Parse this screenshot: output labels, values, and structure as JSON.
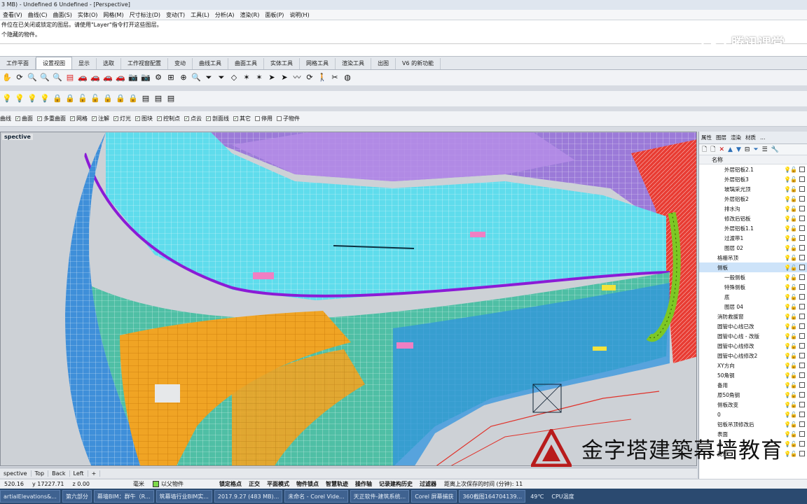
{
  "window": {
    "title": "3 MB) - Undefined 6 Undefined - [Perspective]"
  },
  "menu": [
    "查看(V)",
    "曲线(C)",
    "曲面(S)",
    "实体(O)",
    "网格(M)",
    "尺寸标注(D)",
    "变动(T)",
    "工具(L)",
    "分析(A)",
    "渲染(R)",
    "面板(P)",
    "说明(H)"
  ],
  "command_history": [
    "件位在已关闭或锁定的图层。请使用\"Layer\"指令打开这些图层。",
    "个隐藏的物件。"
  ],
  "watermark": "腾讯课堂",
  "toolbar_tabs": [
    {
      "label": "工作平面",
      "active": false
    },
    {
      "label": "设置视图",
      "active": true
    },
    {
      "label": "显示",
      "active": false
    },
    {
      "label": "选取",
      "active": false
    },
    {
      "label": "工作视窗配置",
      "active": false
    },
    {
      "label": "变动",
      "active": false
    },
    {
      "label": "曲线工具",
      "active": false
    },
    {
      "label": "曲面工具",
      "active": false
    },
    {
      "label": "实体工具",
      "active": false
    },
    {
      "label": "网格工具",
      "active": false
    },
    {
      "label": "渲染工具",
      "active": false
    },
    {
      "label": "出图",
      "active": false
    },
    {
      "label": "V6 的新功能",
      "active": false
    }
  ],
  "tool_icons_row1": [
    "pan-icon",
    "rotate-view-icon",
    "zoom-icon",
    "zoom-window-icon",
    "zoom-extents-icon",
    "layer-red-icon",
    "car-red-icon",
    "car-red-2-icon",
    "car-red-3-icon",
    "car-red-4-icon",
    "camera-icon",
    "camera-2-icon",
    "set-camera-icon",
    "grid-target-icon",
    "target-icon",
    "zoom-target-icon",
    "funnel-icon",
    "funnel-2-icon",
    "plane-icon",
    "star-icon",
    "star-2-icon",
    "arrow-icon",
    "arrow-2-icon",
    "wave-icon",
    "rotate-icon",
    "walk-icon",
    "twist-icon",
    "globe-icon"
  ],
  "tool_icons_row2": [
    "bulb-lock-icon",
    "bulb-icon",
    "bulb-off-icon",
    "bulb-set-icon",
    "lock-icon",
    "lock-2-icon",
    "unlock-icon",
    "unlock-2-icon",
    "lock-set-icon",
    "lock-set-2-icon",
    "lock-set-3-icon",
    "layer-1-icon",
    "layer-2-icon",
    "layer-3-icon"
  ],
  "filters": [
    {
      "label": "曲线",
      "checked": false,
      "has_box": false
    },
    {
      "label": "曲面",
      "checked": true,
      "has_box": true
    },
    {
      "label": "多重曲面",
      "checked": true,
      "has_box": true
    },
    {
      "label": "网格",
      "checked": true,
      "has_box": true
    },
    {
      "label": "注解",
      "checked": true,
      "has_box": true
    },
    {
      "label": "灯光",
      "checked": true,
      "has_box": true
    },
    {
      "label": "图块",
      "checked": true,
      "has_box": true
    },
    {
      "label": "控制点",
      "checked": true,
      "has_box": true
    },
    {
      "label": "点云",
      "checked": true,
      "has_box": true
    },
    {
      "label": "剖面线",
      "checked": true,
      "has_box": true
    },
    {
      "label": "其它",
      "checked": true,
      "has_box": true
    },
    {
      "label": "停用",
      "checked": false,
      "has_box": true
    },
    {
      "label": "子物件",
      "checked": false,
      "has_box": true
    }
  ],
  "viewport": {
    "label": "spective"
  },
  "view_tabs": [
    "spective",
    "Top",
    "Back",
    "Left",
    "+"
  ],
  "panel": {
    "tabs": [
      "属性",
      "图层",
      "渲染",
      "材质",
      "…"
    ],
    "header": "名称",
    "layers": [
      {
        "name": "外层铝板2.1",
        "indent": 36,
        "selected": false,
        "color": "#ffffff"
      },
      {
        "name": "外层铝板3",
        "indent": 36,
        "selected": false,
        "color": "#ffffff"
      },
      {
        "name": "玻璃采光顶",
        "indent": 36,
        "selected": false,
        "color": "#ffffff"
      },
      {
        "name": "外层铝板2",
        "indent": 36,
        "selected": false,
        "color": "#ffffff"
      },
      {
        "name": "排水沟",
        "indent": 36,
        "selected": false,
        "color": "#ffffff"
      },
      {
        "name": "修改后铝板",
        "indent": 36,
        "selected": false,
        "color": "#ffffff"
      },
      {
        "name": "外层铝板1.1",
        "indent": 36,
        "selected": false,
        "color": "#ffffff"
      },
      {
        "name": "过渡带1",
        "indent": 36,
        "selected": false,
        "color": "#ffffff"
      },
      {
        "name": "图层 02",
        "indent": 36,
        "selected": false,
        "color": "#ffffff"
      },
      {
        "name": "格栅吊顶",
        "indent": 26,
        "selected": false,
        "color": "#ffffff"
      },
      {
        "name": "侧板",
        "indent": 26,
        "selected": true,
        "color": "#ffffff"
      },
      {
        "name": "一般侧板",
        "indent": 36,
        "selected": false,
        "color": "#ffffff"
      },
      {
        "name": "特殊侧板",
        "indent": 36,
        "selected": false,
        "color": "#ffffff"
      },
      {
        "name": "底",
        "indent": 36,
        "selected": false,
        "color": "#ffffff"
      },
      {
        "name": "图层 04",
        "indent": 36,
        "selected": false,
        "color": "#ffffff"
      },
      {
        "name": "消防救援窗",
        "indent": 26,
        "selected": false,
        "color": "#ffffff"
      },
      {
        "name": "圆管中心线已改",
        "indent": 26,
        "selected": false,
        "color": "#ffffff"
      },
      {
        "name": "圆管中心线 - 改版",
        "indent": 26,
        "selected": false,
        "color": "#ffffff"
      },
      {
        "name": "圆管中心线修改",
        "indent": 26,
        "selected": false,
        "color": "#ffffff"
      },
      {
        "name": "圆管中心线修改2",
        "indent": 26,
        "selected": false,
        "color": "#ffffff"
      },
      {
        "name": "XY方向",
        "indent": 26,
        "selected": false,
        "color": "#ffffff"
      },
      {
        "name": "50角钢",
        "indent": 26,
        "selected": false,
        "color": "#ffffff"
      },
      {
        "name": "备用",
        "indent": 26,
        "selected": false,
        "color": "#ffffff"
      },
      {
        "name": "原50角钢",
        "indent": 26,
        "selected": false,
        "color": "#ffffff"
      },
      {
        "name": "侧板改变",
        "indent": 26,
        "selected": false,
        "color": "#ffffff"
      },
      {
        "name": "0",
        "indent": 26,
        "selected": false,
        "color": "#ffffff"
      },
      {
        "name": "铝板吊顶修改后",
        "indent": 26,
        "selected": false,
        "color": "#ffffff"
      },
      {
        "name": "表面",
        "indent": 26,
        "selected": false,
        "color": "#ffffff"
      },
      {
        "name": "点",
        "indent": 26,
        "selected": false,
        "color": "#ffffff"
      },
      {
        "name": "变形",
        "indent": 26,
        "selected": false,
        "color": "#ffffff"
      }
    ]
  },
  "status": {
    "coord_x": "520.16",
    "coord_y": "y 17227.71",
    "coord_z": "z 0.00",
    "unit": "毫米",
    "layer": "以父物件",
    "toggles": [
      "锁定格点",
      "正交",
      "平面模式",
      "物件锁点",
      "智慧轨迹",
      "操作轴",
      "记录建构历史",
      "过滤器"
    ],
    "message": "距离上次保存的时间 (分钟): 11"
  },
  "taskbar": [
    "artialElevations&...",
    "第六部分",
    "幕墙BIM：群牛（R...",
    "筑幕墙行业BIM实...",
    "2017.9.27 (483 MB)...",
    "未命名 - Corel Vide...",
    "天正软件-建筑系统...",
    "Corel 屏幕捕获",
    "360截图164704139...",
    "49℃",
    "CPU温度"
  ],
  "brand": "金字塔建築幕墙教育",
  "colors": {
    "accent": "#2c6fb7",
    "selection": "#cde3f9",
    "taskbar": "#2b4a70"
  }
}
